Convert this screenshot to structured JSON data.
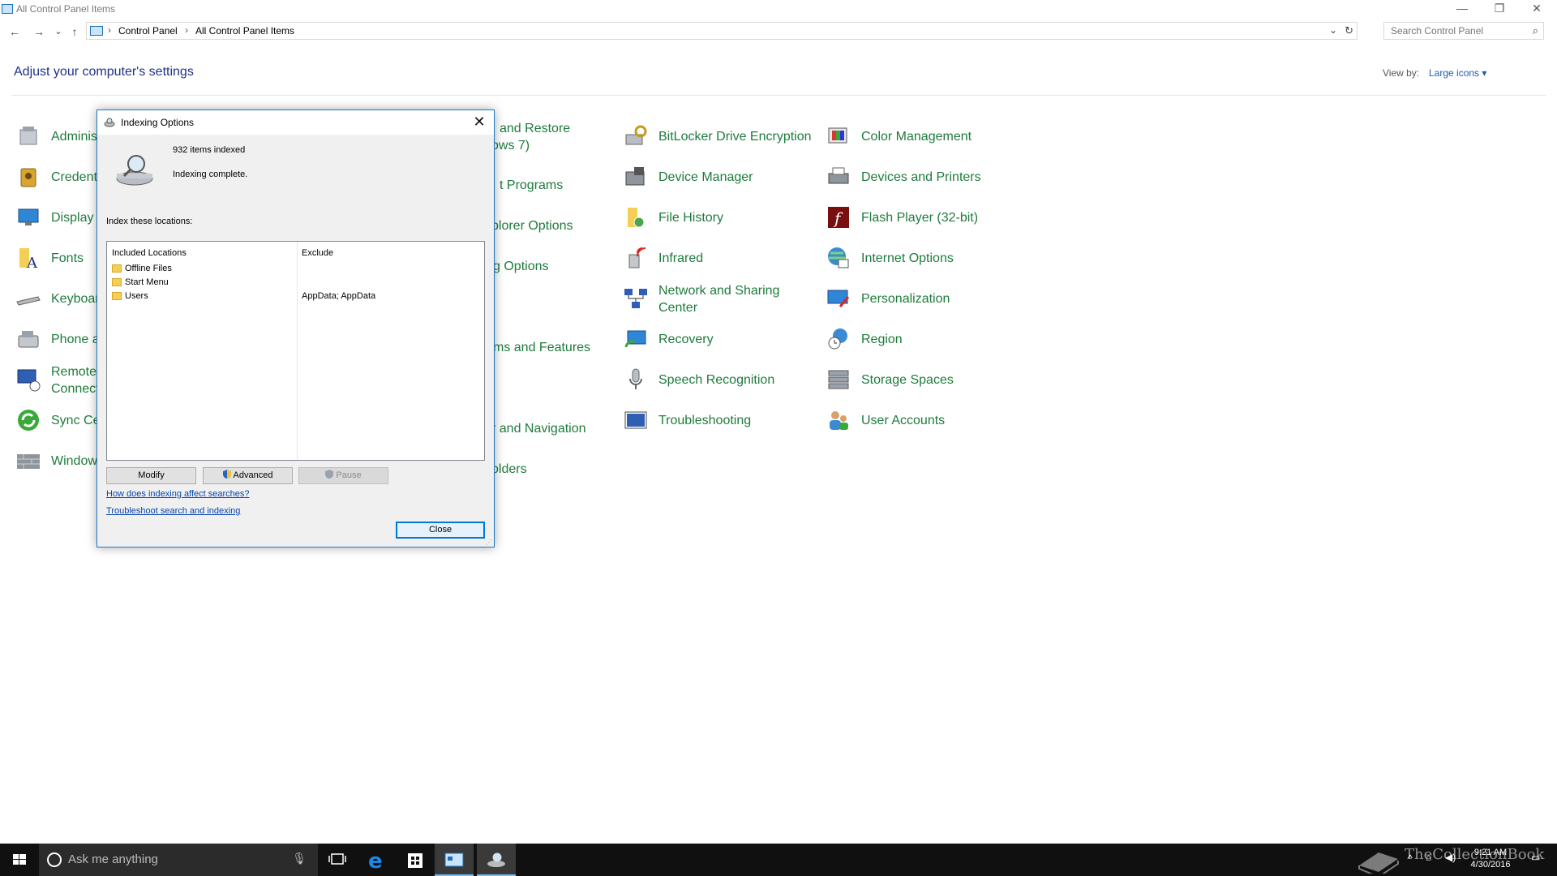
{
  "window": {
    "title": "All Control Panel Items",
    "controls": {
      "minimize": "—",
      "restore": "❐",
      "close": "✕"
    }
  },
  "nav": {
    "back": "←",
    "forward": "→",
    "recent": "⌄",
    "up": "↑",
    "breadcrumb": [
      "Control Panel",
      "All Control Panel Items"
    ],
    "dropdown": "⌄",
    "refresh": "↻",
    "search_placeholder": "Search Control Panel",
    "search_icon": "⌕"
  },
  "main": {
    "heading": "Adjust your computer's settings",
    "view_by_label": "View by:",
    "view_by_value": "Large icons ▾"
  },
  "items": {
    "col1": [
      "Adminis",
      "Credenti",
      "Display",
      "Fonts",
      "Keyboar",
      "Phone a",
      "Remote",
      "Connect",
      "Sync Ce",
      "Window"
    ],
    "col2": [
      "and Restore",
      "ows 7)",
      "t Programs",
      "plorer Options",
      "g Options",
      "ms and Features",
      "r and Navigation",
      "olders"
    ],
    "col3": [
      "BitLocker Drive Encryption",
      "Device Manager",
      "File History",
      "Infrared",
      "Network and Sharing",
      "Center",
      "Recovery",
      "Speech Recognition",
      "Troubleshooting"
    ],
    "col4": [
      "Color Management",
      "Devices and Printers",
      "Flash Player (32-bit)",
      "Internet Options",
      "Personalization",
      "Region",
      "Storage Spaces",
      "User Accounts"
    ]
  },
  "dialog": {
    "title": "Indexing Options",
    "items_indexed": "932 items indexed",
    "status": "Indexing complete.",
    "index_label": "Index these locations:",
    "col_included": "Included Locations",
    "col_exclude": "Exclude",
    "locations": [
      "Offline Files",
      "Start Menu",
      "Users"
    ],
    "users_exclude": "AppData; AppData",
    "btn_modify": "Modify",
    "btn_advanced": "Advanced",
    "btn_pause": "Pause",
    "link_how": "How does indexing affect searches?",
    "link_troubleshoot": "Troubleshoot search and indexing",
    "btn_close": "Close",
    "close_x": "✕"
  },
  "taskbar": {
    "search_placeholder": "Ask me anything",
    "time": "9:21 AM",
    "date": "4/30/2016",
    "watermark": "TheCollectionBook"
  }
}
